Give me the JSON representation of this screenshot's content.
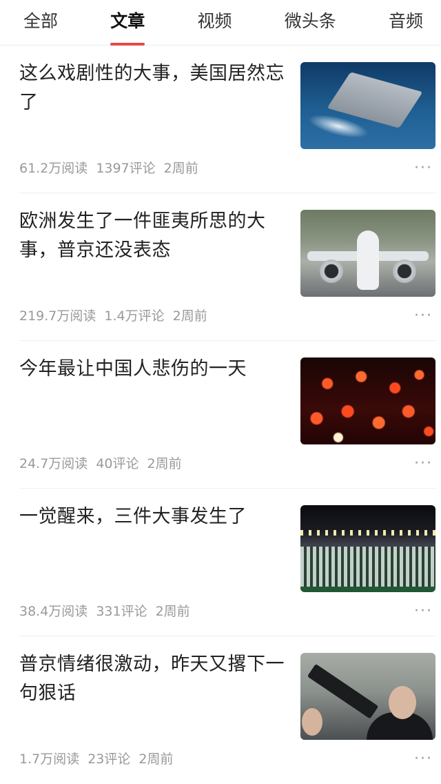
{
  "tabs": [
    {
      "label": "全部",
      "active": false
    },
    {
      "label": "文章",
      "active": true
    },
    {
      "label": "视频",
      "active": false
    },
    {
      "label": "微头条",
      "active": false
    },
    {
      "label": "音频",
      "active": false
    }
  ],
  "accent_color": "#e8474a",
  "articles": [
    {
      "title": "这么戏剧性的大事，美国居然忘了",
      "reads": "61.2万阅读",
      "comments": "1397评论",
      "time": "2周前",
      "thumbnail": "aircraft-carrier"
    },
    {
      "title": "欧洲发生了一件匪夷所思的大事，普京还没表态",
      "reads": "219.7万阅读",
      "comments": "1.4万评论",
      "time": "2周前",
      "thumbnail": "airplane"
    },
    {
      "title": "今年最让中国人悲伤的一天",
      "reads": "24.7万阅读",
      "comments": "40评论",
      "time": "2周前",
      "thumbnail": "candles"
    },
    {
      "title": "一觉醒来，三件大事发生了",
      "reads": "38.4万阅读",
      "comments": "331评论",
      "time": "2周前",
      "thumbnail": "crowd-stadium"
    },
    {
      "title": "普京情绪很激动，昨天又撂下一句狠话",
      "reads": "1.7万阅读",
      "comments": "23评论",
      "time": "2周前",
      "thumbnail": "putin-with-gun"
    }
  ],
  "more_icon": "more-dots-icon",
  "more_label": "···"
}
